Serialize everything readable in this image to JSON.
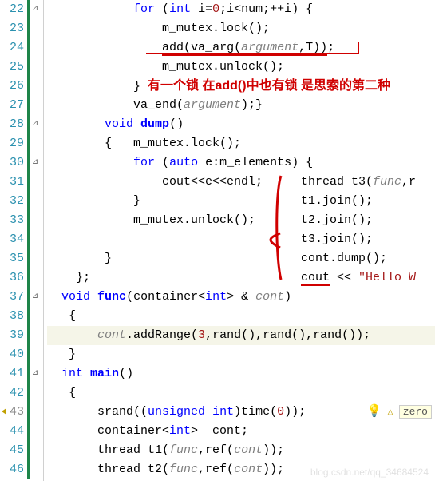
{
  "editor": {
    "lines": [
      {
        "n": "22",
        "fold": "⊿",
        "code": [
          {
            "t": "            ",
            "c": ""
          },
          {
            "t": "for",
            "c": "kw"
          },
          {
            "t": " (",
            "c": ""
          },
          {
            "t": "int",
            "c": "ty"
          },
          {
            "t": " i=",
            "c": ""
          },
          {
            "t": "0",
            "c": "num2"
          },
          {
            "t": ";i<num;++i) {",
            "c": ""
          }
        ]
      },
      {
        "n": "23",
        "fold": "",
        "code": [
          {
            "t": "                m_mutex.lock();",
            "c": ""
          }
        ]
      },
      {
        "n": "24",
        "fold": "",
        "code": [
          {
            "t": "                ",
            "c": ""
          },
          {
            "t": "add",
            "c": "",
            "u": true
          },
          {
            "t": "(",
            "c": "",
            "u": true
          },
          {
            "t": "va_arg",
            "c": "",
            "u": true
          },
          {
            "t": "(",
            "c": "",
            "u": true
          },
          {
            "t": "argument",
            "c": "arg",
            "u": true
          },
          {
            "t": ",",
            "c": "",
            "u": true
          },
          {
            "t": "T",
            "c": "",
            "u": true
          },
          {
            "t": "))",
            "c": "",
            "u": true
          },
          {
            "t": ";",
            "c": ""
          }
        ]
      },
      {
        "n": "25",
        "fold": "",
        "code": [
          {
            "t": "                m_mutex.unlock();",
            "c": ""
          }
        ]
      },
      {
        "n": "26",
        "fold": "",
        "code": [
          {
            "t": "            } ",
            "c": ""
          }
        ],
        "annot": "有一个锁 在add()中也有锁 是思索的第二种"
      },
      {
        "n": "27",
        "fold": "",
        "code": [
          {
            "t": "            va_end(",
            "c": ""
          },
          {
            "t": "argument",
            "c": "arg"
          },
          {
            "t": ");}",
            "c": ""
          }
        ]
      },
      {
        "n": "28",
        "fold": "⊿",
        "code": [
          {
            "t": "        ",
            "c": ""
          },
          {
            "t": "void",
            "c": "ty"
          },
          {
            "t": " ",
            "c": ""
          },
          {
            "t": "dump",
            "c": "fn"
          },
          {
            "t": "()",
            "c": ""
          }
        ]
      },
      {
        "n": "29",
        "fold": "",
        "code": [
          {
            "t": "        {   m_mutex.lock();",
            "c": ""
          }
        ]
      },
      {
        "n": "30",
        "fold": "⊿",
        "code": [
          {
            "t": "            ",
            "c": ""
          },
          {
            "t": "for",
            "c": "kw"
          },
          {
            "t": " (",
            "c": ""
          },
          {
            "t": "auto",
            "c": "kw"
          },
          {
            "t": " e:m_elements) {",
            "c": ""
          }
        ]
      },
      {
        "n": "31",
        "fold": "",
        "code": [
          {
            "t": "                cout<<e<<endl;",
            "c": ""
          }
        ],
        "over": [
          {
            "t": "  thread t3(",
            "c": ""
          },
          {
            "t": "func",
            "c": "arg"
          },
          {
            "t": ",r",
            "c": ""
          }
        ]
      },
      {
        "n": "32",
        "fold": "",
        "code": [
          {
            "t": "            }",
            "c": ""
          }
        ],
        "over": [
          {
            "t": "  t1.join();",
            "c": ""
          }
        ]
      },
      {
        "n": "33",
        "fold": "",
        "code": [
          {
            "t": "            m_mutex.unlock();",
            "c": ""
          }
        ],
        "over": [
          {
            "t": "  t2.join();",
            "c": ""
          }
        ]
      },
      {
        "n": "34",
        "fold": "",
        "code": [
          {
            "t": "",
            "c": ""
          }
        ],
        "over": [
          {
            "t": "  t3.join();",
            "c": ""
          }
        ]
      },
      {
        "n": "35",
        "fold": "",
        "code": [
          {
            "t": "        }",
            "c": ""
          }
        ],
        "over": [
          {
            "t": "  cont.dump();",
            "c": ""
          }
        ]
      },
      {
        "n": "36",
        "fold": "",
        "code": [
          {
            "t": "    };",
            "c": ""
          }
        ],
        "over": [
          {
            "t": "  ",
            "c": ""
          },
          {
            "t": "cout",
            "c": "",
            "u": true
          },
          {
            "t": " << ",
            "c": ""
          },
          {
            "t": "\"Hello W",
            "c": "str"
          }
        ]
      },
      {
        "n": "37",
        "fold": "⊿",
        "code": [
          {
            "t": "  ",
            "c": ""
          },
          {
            "t": "void",
            "c": "ty"
          },
          {
            "t": " ",
            "c": ""
          },
          {
            "t": "func",
            "c": "fn"
          },
          {
            "t": "(container<",
            "c": ""
          },
          {
            "t": "int",
            "c": "ty"
          },
          {
            "t": "> & ",
            "c": ""
          },
          {
            "t": "cont",
            "c": "arg"
          },
          {
            "t": ")",
            "c": ""
          }
        ]
      },
      {
        "n": "38",
        "fold": "",
        "code": [
          {
            "t": "   {",
            "c": ""
          }
        ]
      },
      {
        "n": "39",
        "fold": "",
        "current": true,
        "code": [
          {
            "t": "       ",
            "c": ""
          },
          {
            "t": "cont",
            "c": "arg"
          },
          {
            "t": ".addRange(",
            "c": ""
          },
          {
            "t": "3",
            "c": "num2"
          },
          {
            "t": ",rand(),rand(),rand());",
            "c": ""
          }
        ]
      },
      {
        "n": "40",
        "fold": "",
        "code": [
          {
            "t": "   }",
            "c": ""
          }
        ]
      },
      {
        "n": "41",
        "fold": "⊿",
        "code": [
          {
            "t": "  ",
            "c": ""
          },
          {
            "t": "int",
            "c": "ty"
          },
          {
            "t": " ",
            "c": ""
          },
          {
            "t": "main",
            "c": "fn"
          },
          {
            "t": "()",
            "c": ""
          }
        ]
      },
      {
        "n": "42",
        "fold": "",
        "code": [
          {
            "t": "   {",
            "c": ""
          }
        ]
      },
      {
        "n": "43",
        "fold": "",
        "arrow": true,
        "code": [
          {
            "t": "       srand((",
            "c": ""
          },
          {
            "t": "unsigned",
            "c": "ty"
          },
          {
            "t": " ",
            "c": ""
          },
          {
            "t": "int",
            "c": "ty"
          },
          {
            "t": ")time(",
            "c": ""
          },
          {
            "t": "0",
            "c": "num2"
          },
          {
            "t": "));",
            "c": ""
          }
        ],
        "warn": {
          "bulb": "💡",
          "tri": "△",
          "text": "zero"
        }
      },
      {
        "n": "44",
        "fold": "",
        "code": [
          {
            "t": "       container<",
            "c": ""
          },
          {
            "t": "int",
            "c": "ty"
          },
          {
            "t": ">  cont;",
            "c": ""
          }
        ]
      },
      {
        "n": "45",
        "fold": "",
        "code": [
          {
            "t": "       thread t1(",
            "c": ""
          },
          {
            "t": "func",
            "c": "arg"
          },
          {
            "t": ",ref(",
            "c": ""
          },
          {
            "t": "cont",
            "c": "arg"
          },
          {
            "t": "));",
            "c": ""
          }
        ]
      },
      {
        "n": "46",
        "fold": "",
        "code": [
          {
            "t": "       thread t2(",
            "c": ""
          },
          {
            "t": "func",
            "c": "arg"
          },
          {
            "t": ",ref(",
            "c": ""
          },
          {
            "t": "cont",
            "c": "arg"
          },
          {
            "t": "));",
            "c": ""
          }
        ]
      }
    ]
  },
  "watermark": "blog.csdn.net/qq_34684524"
}
